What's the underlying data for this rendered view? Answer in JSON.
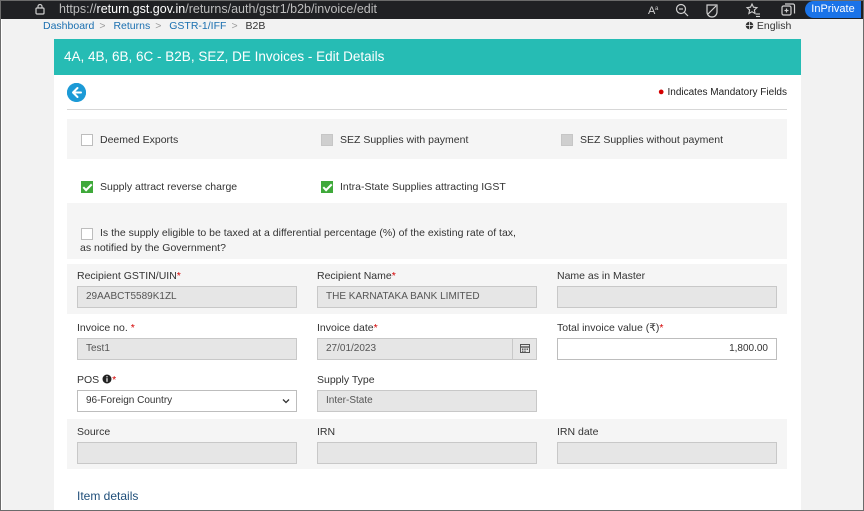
{
  "browser": {
    "url_prefix": "https://",
    "url_host": "return.gst.gov.in",
    "url_path": "/returns/auth/gstr1/b2b/invoice/edit",
    "inprivate_label": "InPrivate"
  },
  "breadcrumb": {
    "items": [
      "Dashboard",
      "Returns",
      "GSTR-1/IFF",
      "B2B"
    ],
    "separator": ">"
  },
  "language": "English",
  "panel": {
    "title": "4A, 4B, 6B, 6C - B2B, SEZ, DE Invoices - Edit Details",
    "mandatory_note": "Indicates Mandatory Fields"
  },
  "checkboxes": {
    "deemed_exports": {
      "label": "Deemed Exports",
      "checked": false,
      "disabled": false
    },
    "sez_with_payment": {
      "label": "SEZ Supplies with payment",
      "checked": false,
      "disabled": true
    },
    "sez_without_payment": {
      "label": "SEZ Supplies without payment",
      "checked": false,
      "disabled": true
    },
    "reverse_charge": {
      "label": "Supply attract reverse charge",
      "checked": true,
      "disabled": false
    },
    "intra_state_igst": {
      "label": "Intra-State Supplies attracting IGST",
      "checked": true,
      "disabled": false
    },
    "differential_rate": {
      "label_line1": "Is the supply eligible to be taxed at a differential percentage (%) of the existing rate of tax,",
      "label_line2": "as notified by the Government?",
      "checked": false
    }
  },
  "fields": {
    "recipient_gstin": {
      "label": "Recipient GSTIN/UIN",
      "value": "29AABCT5589K1ZL",
      "required": true
    },
    "recipient_name": {
      "label": "Recipient Name",
      "value": "THE KARNATAKA BANK LIMITED",
      "required": true
    },
    "name_in_master": {
      "label": "Name as in Master",
      "value": ""
    },
    "invoice_no": {
      "label": "Invoice no.",
      "value": "Test1",
      "required": true
    },
    "invoice_date": {
      "label": "Invoice date",
      "value": "27/01/2023",
      "required": true
    },
    "total_invoice_value": {
      "label": "Total invoice value (₹)",
      "value": "1,800.00",
      "required": true
    },
    "pos": {
      "label": "POS",
      "value": "96-Foreign Country",
      "required": true
    },
    "supply_type": {
      "label": "Supply Type",
      "value": "Inter-State"
    },
    "source": {
      "label": "Source",
      "value": ""
    },
    "irn": {
      "label": "IRN",
      "value": ""
    },
    "irn_date": {
      "label": "IRN date",
      "value": ""
    }
  },
  "item_details_heading": "Item details",
  "colors": {
    "header_teal": "#26bcb4",
    "back_button_blue": "#1c9ad6",
    "checkbox_green": "#3fa93a",
    "required_red": "#d40000",
    "link_blue": "#1a6fb0"
  },
  "icons": {
    "back": "arrow-left-circle-icon",
    "info": "info-circle-icon",
    "calendar": "calendar-icon",
    "dropdown": "chevron-down-icon",
    "lock": "lock-icon",
    "globe": "globe-icon"
  }
}
